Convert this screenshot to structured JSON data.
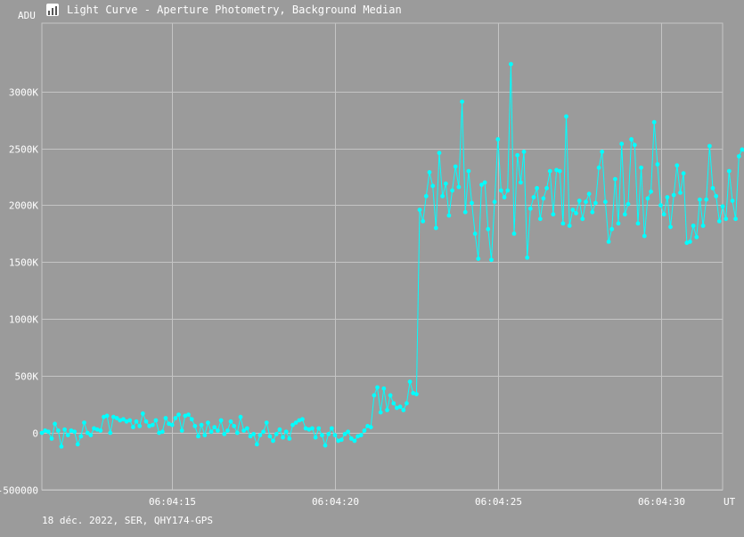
{
  "window": {
    "title": "Light Curve - Aperture Photometry, Background Median",
    "icon": "chart-app-icon"
  },
  "footer": "18 déc. 2022, SER, QHY174-GPS",
  "colors": {
    "background": "#9b9b9b",
    "grid": "#c4c4c4",
    "series": "#00ffff",
    "text": "#ffffff"
  },
  "chart_data": {
    "type": "line",
    "title": "Light Curve - Aperture Photometry, Background Median",
    "ylabel": "ADU",
    "xlabel": "UT",
    "ylim": [
      -500000,
      3600000
    ],
    "xlim": [
      "06:04:11.0",
      "06:04:31.9"
    ],
    "y_ticks": [
      -500000,
      0,
      500000,
      1000000,
      1500000,
      2000000,
      2500000,
      3000000
    ],
    "y_tick_labels": [
      "-500000",
      "0",
      "500K",
      "1000K",
      "1500K",
      "2000K",
      "2500K",
      "3000K"
    ],
    "x_ticks": [
      "06:04:15",
      "06:04:20",
      "06:04:25",
      "06:04:30"
    ],
    "grid": true,
    "legend": "none",
    "series": [
      {
        "x_start": "06:04:11.0",
        "x_step_s": 0.1,
        "values": [
          0,
          20000,
          10000,
          -50000,
          80000,
          20000,
          -120000,
          30000,
          -20000,
          20000,
          10000,
          -100000,
          -30000,
          90000,
          0,
          -20000,
          40000,
          30000,
          20000,
          140000,
          150000,
          0,
          140000,
          130000,
          110000,
          120000,
          100000,
          110000,
          50000,
          100000,
          60000,
          170000,
          100000,
          60000,
          70000,
          110000,
          0,
          10000,
          130000,
          80000,
          70000,
          130000,
          160000,
          20000,
          150000,
          160000,
          120000,
          60000,
          -30000,
          70000,
          -20000,
          90000,
          10000,
          50000,
          20000,
          110000,
          -10000,
          20000,
          100000,
          60000,
          0,
          140000,
          20000,
          40000,
          -30000,
          -10000,
          -100000,
          -20000,
          10000,
          90000,
          -30000,
          -70000,
          -10000,
          30000,
          -40000,
          10000,
          -50000,
          70000,
          90000,
          110000,
          120000,
          40000,
          30000,
          40000,
          -40000,
          40000,
          -20000,
          -110000,
          -10000,
          40000,
          -20000,
          -70000,
          -60000,
          -10000,
          10000,
          -50000,
          -70000,
          -30000,
          -20000,
          20000,
          60000,
          50000,
          330000,
          400000,
          180000,
          390000,
          200000,
          330000,
          260000,
          220000,
          230000,
          200000,
          260000,
          450000,
          350000,
          340000,
          1960000,
          1860000,
          2080000,
          2290000,
          2170000,
          1800000,
          2460000,
          2080000,
          2190000,
          1910000,
          2130000,
          2340000,
          2160000,
          2910000,
          1940000,
          2300000,
          2020000,
          1750000,
          1530000,
          2180000,
          2200000,
          1790000,
          1520000,
          2030000,
          2580000,
          2130000,
          2070000,
          2130000,
          3240000,
          1750000,
          2440000,
          2200000,
          2470000,
          1540000,
          1970000,
          2070000,
          2150000,
          1880000,
          2060000,
          2150000,
          2300000,
          1920000,
          2310000,
          2300000,
          1840000,
          2780000,
          1820000,
          1960000,
          1930000,
          2040000,
          1880000,
          2030000,
          2100000,
          1940000,
          2020000,
          2330000,
          2470000,
          2030000,
          1680000,
          1790000,
          2230000,
          1840000,
          2540000,
          1920000,
          2010000,
          2580000,
          2530000,
          1840000,
          2330000,
          1730000,
          2060000,
          2120000,
          2730000,
          2360000,
          2000000,
          1920000,
          2070000,
          1810000,
          2090000,
          2350000,
          2110000,
          2280000,
          1670000,
          1680000,
          1820000,
          1720000,
          2050000,
          1820000,
          2050000,
          2520000,
          2150000,
          2080000,
          1860000,
          1990000,
          1880000,
          2300000,
          2040000,
          1880000,
          2430000,
          2490000,
          2480000
        ]
      }
    ]
  }
}
